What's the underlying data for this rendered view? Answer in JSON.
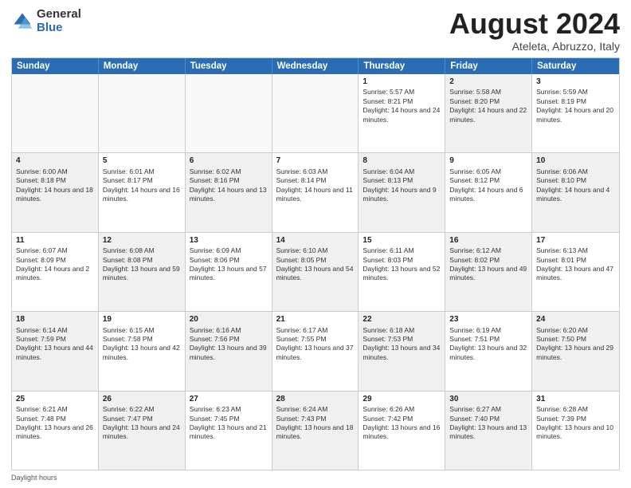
{
  "logo": {
    "general": "General",
    "blue": "Blue"
  },
  "title": "August 2024",
  "location": "Ateleta, Abruzzo, Italy",
  "days_of_week": [
    "Sunday",
    "Monday",
    "Tuesday",
    "Wednesday",
    "Thursday",
    "Friday",
    "Saturday"
  ],
  "footer": "Daylight hours",
  "weeks": [
    [
      {
        "day": "",
        "info": "",
        "shaded": true
      },
      {
        "day": "",
        "info": "",
        "shaded": true
      },
      {
        "day": "",
        "info": "",
        "shaded": true
      },
      {
        "day": "",
        "info": "",
        "shaded": true
      },
      {
        "day": "1",
        "info": "Sunrise: 5:57 AM\nSunset: 8:21 PM\nDaylight: 14 hours and 24 minutes.",
        "shaded": false
      },
      {
        "day": "2",
        "info": "Sunrise: 5:58 AM\nSunset: 8:20 PM\nDaylight: 14 hours and 22 minutes.",
        "shaded": true
      },
      {
        "day": "3",
        "info": "Sunrise: 5:59 AM\nSunset: 8:19 PM\nDaylight: 14 hours and 20 minutes.",
        "shaded": false
      }
    ],
    [
      {
        "day": "4",
        "info": "Sunrise: 6:00 AM\nSunset: 8:18 PM\nDaylight: 14 hours and 18 minutes.",
        "shaded": true
      },
      {
        "day": "5",
        "info": "Sunrise: 6:01 AM\nSunset: 8:17 PM\nDaylight: 14 hours and 16 minutes.",
        "shaded": false
      },
      {
        "day": "6",
        "info": "Sunrise: 6:02 AM\nSunset: 8:16 PM\nDaylight: 14 hours and 13 minutes.",
        "shaded": true
      },
      {
        "day": "7",
        "info": "Sunrise: 6:03 AM\nSunset: 8:14 PM\nDaylight: 14 hours and 11 minutes.",
        "shaded": false
      },
      {
        "day": "8",
        "info": "Sunrise: 6:04 AM\nSunset: 8:13 PM\nDaylight: 14 hours and 9 minutes.",
        "shaded": true
      },
      {
        "day": "9",
        "info": "Sunrise: 6:05 AM\nSunset: 8:12 PM\nDaylight: 14 hours and 6 minutes.",
        "shaded": false
      },
      {
        "day": "10",
        "info": "Sunrise: 6:06 AM\nSunset: 8:10 PM\nDaylight: 14 hours and 4 minutes.",
        "shaded": true
      }
    ],
    [
      {
        "day": "11",
        "info": "Sunrise: 6:07 AM\nSunset: 8:09 PM\nDaylight: 14 hours and 2 minutes.",
        "shaded": false
      },
      {
        "day": "12",
        "info": "Sunrise: 6:08 AM\nSunset: 8:08 PM\nDaylight: 13 hours and 59 minutes.",
        "shaded": true
      },
      {
        "day": "13",
        "info": "Sunrise: 6:09 AM\nSunset: 8:06 PM\nDaylight: 13 hours and 57 minutes.",
        "shaded": false
      },
      {
        "day": "14",
        "info": "Sunrise: 6:10 AM\nSunset: 8:05 PM\nDaylight: 13 hours and 54 minutes.",
        "shaded": true
      },
      {
        "day": "15",
        "info": "Sunrise: 6:11 AM\nSunset: 8:03 PM\nDaylight: 13 hours and 52 minutes.",
        "shaded": false
      },
      {
        "day": "16",
        "info": "Sunrise: 6:12 AM\nSunset: 8:02 PM\nDaylight: 13 hours and 49 minutes.",
        "shaded": true
      },
      {
        "day": "17",
        "info": "Sunrise: 6:13 AM\nSunset: 8:01 PM\nDaylight: 13 hours and 47 minutes.",
        "shaded": false
      }
    ],
    [
      {
        "day": "18",
        "info": "Sunrise: 6:14 AM\nSunset: 7:59 PM\nDaylight: 13 hours and 44 minutes.",
        "shaded": true
      },
      {
        "day": "19",
        "info": "Sunrise: 6:15 AM\nSunset: 7:58 PM\nDaylight: 13 hours and 42 minutes.",
        "shaded": false
      },
      {
        "day": "20",
        "info": "Sunrise: 6:16 AM\nSunset: 7:56 PM\nDaylight: 13 hours and 39 minutes.",
        "shaded": true
      },
      {
        "day": "21",
        "info": "Sunrise: 6:17 AM\nSunset: 7:55 PM\nDaylight: 13 hours and 37 minutes.",
        "shaded": false
      },
      {
        "day": "22",
        "info": "Sunrise: 6:18 AM\nSunset: 7:53 PM\nDaylight: 13 hours and 34 minutes.",
        "shaded": true
      },
      {
        "day": "23",
        "info": "Sunrise: 6:19 AM\nSunset: 7:51 PM\nDaylight: 13 hours and 32 minutes.",
        "shaded": false
      },
      {
        "day": "24",
        "info": "Sunrise: 6:20 AM\nSunset: 7:50 PM\nDaylight: 13 hours and 29 minutes.",
        "shaded": true
      }
    ],
    [
      {
        "day": "25",
        "info": "Sunrise: 6:21 AM\nSunset: 7:48 PM\nDaylight: 13 hours and 26 minutes.",
        "shaded": false
      },
      {
        "day": "26",
        "info": "Sunrise: 6:22 AM\nSunset: 7:47 PM\nDaylight: 13 hours and 24 minutes.",
        "shaded": true
      },
      {
        "day": "27",
        "info": "Sunrise: 6:23 AM\nSunset: 7:45 PM\nDaylight: 13 hours and 21 minutes.",
        "shaded": false
      },
      {
        "day": "28",
        "info": "Sunrise: 6:24 AM\nSunset: 7:43 PM\nDaylight: 13 hours and 18 minutes.",
        "shaded": true
      },
      {
        "day": "29",
        "info": "Sunrise: 6:26 AM\nSunset: 7:42 PM\nDaylight: 13 hours and 16 minutes.",
        "shaded": false
      },
      {
        "day": "30",
        "info": "Sunrise: 6:27 AM\nSunset: 7:40 PM\nDaylight: 13 hours and 13 minutes.",
        "shaded": true
      },
      {
        "day": "31",
        "info": "Sunrise: 6:28 AM\nSunset: 7:39 PM\nDaylight: 13 hours and 10 minutes.",
        "shaded": false
      }
    ]
  ]
}
